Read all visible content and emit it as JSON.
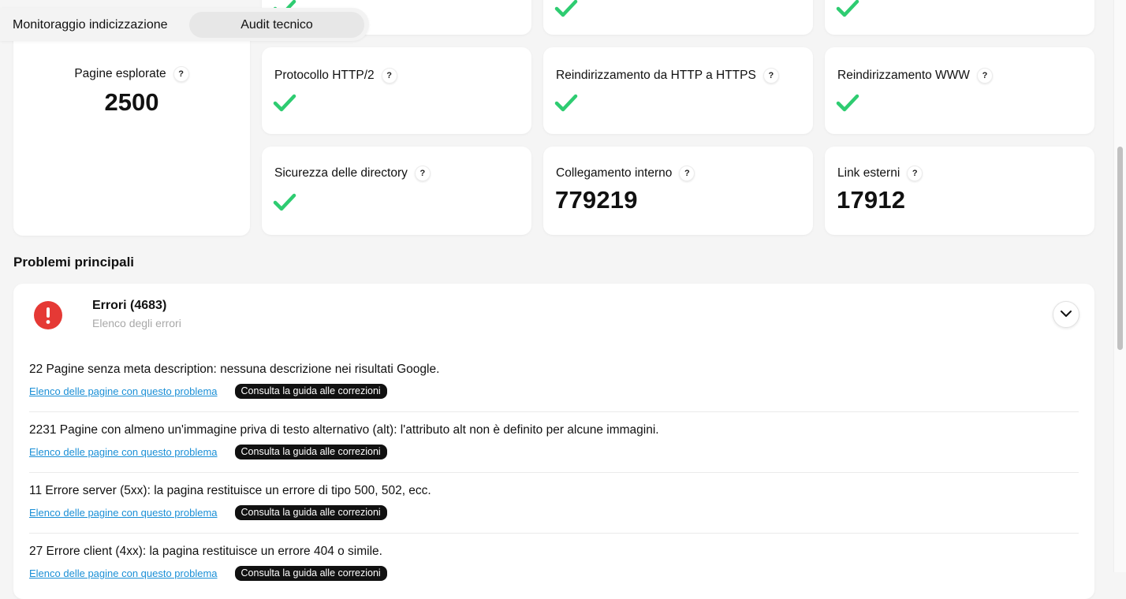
{
  "tabs": {
    "items": [
      {
        "label": "Monitoraggio indicizzazione",
        "active": false
      },
      {
        "label": "Audit tecnico",
        "active": true
      }
    ]
  },
  "pages_card": {
    "title": "Pagine esplorate",
    "value": "2500"
  },
  "help_symbol": "?",
  "cards": {
    "http2": {
      "title": "Protocollo HTTP/2",
      "status": "check"
    },
    "https_redirect": {
      "title": "Reindirizzamento da HTTP a HTTPS",
      "status": "check"
    },
    "www_redirect": {
      "title": "Reindirizzamento WWW",
      "status": "check"
    },
    "directory_security": {
      "title": "Sicurezza delle directory",
      "status": "check"
    },
    "internal_links": {
      "title": "Collegamento interno",
      "value": "779219"
    },
    "external_links": {
      "title": "Link esterni",
      "value": "17912"
    }
  },
  "main_issues": {
    "title": "Problemi principali",
    "errors": {
      "heading": "Errori (4683)",
      "subtitle": "Elenco degli errori",
      "items": [
        {
          "text": "22 Pagine senza meta description: nessuna descrizione nei risultati Google.",
          "link": "Elenco delle pagine con questo problema",
          "guide": "Consulta la guida alle correzioni"
        },
        {
          "text": "2231 Pagine con almeno un'immagine priva di testo alternativo (alt): l'attributo alt non è definito per alcune immagini.",
          "link": "Elenco delle pagine con questo problema",
          "guide": "Consulta la guida alle correzioni"
        },
        {
          "text": "11 Errore server (5xx): la pagina restituisce un errore di tipo 500, 502, ecc.",
          "link": "Elenco delle pagine con questo problema",
          "guide": "Consulta la guida alle correzioni"
        },
        {
          "text": "27 Errore client (4xx): la pagina restituisce un errore 404 o simile.",
          "link": "Elenco delle pagine con questo problema",
          "guide": "Consulta la guida alle correzioni"
        }
      ]
    }
  },
  "colors": {
    "check": "#2ecc71",
    "error": "#e53935",
    "link": "#1a8fd6"
  }
}
